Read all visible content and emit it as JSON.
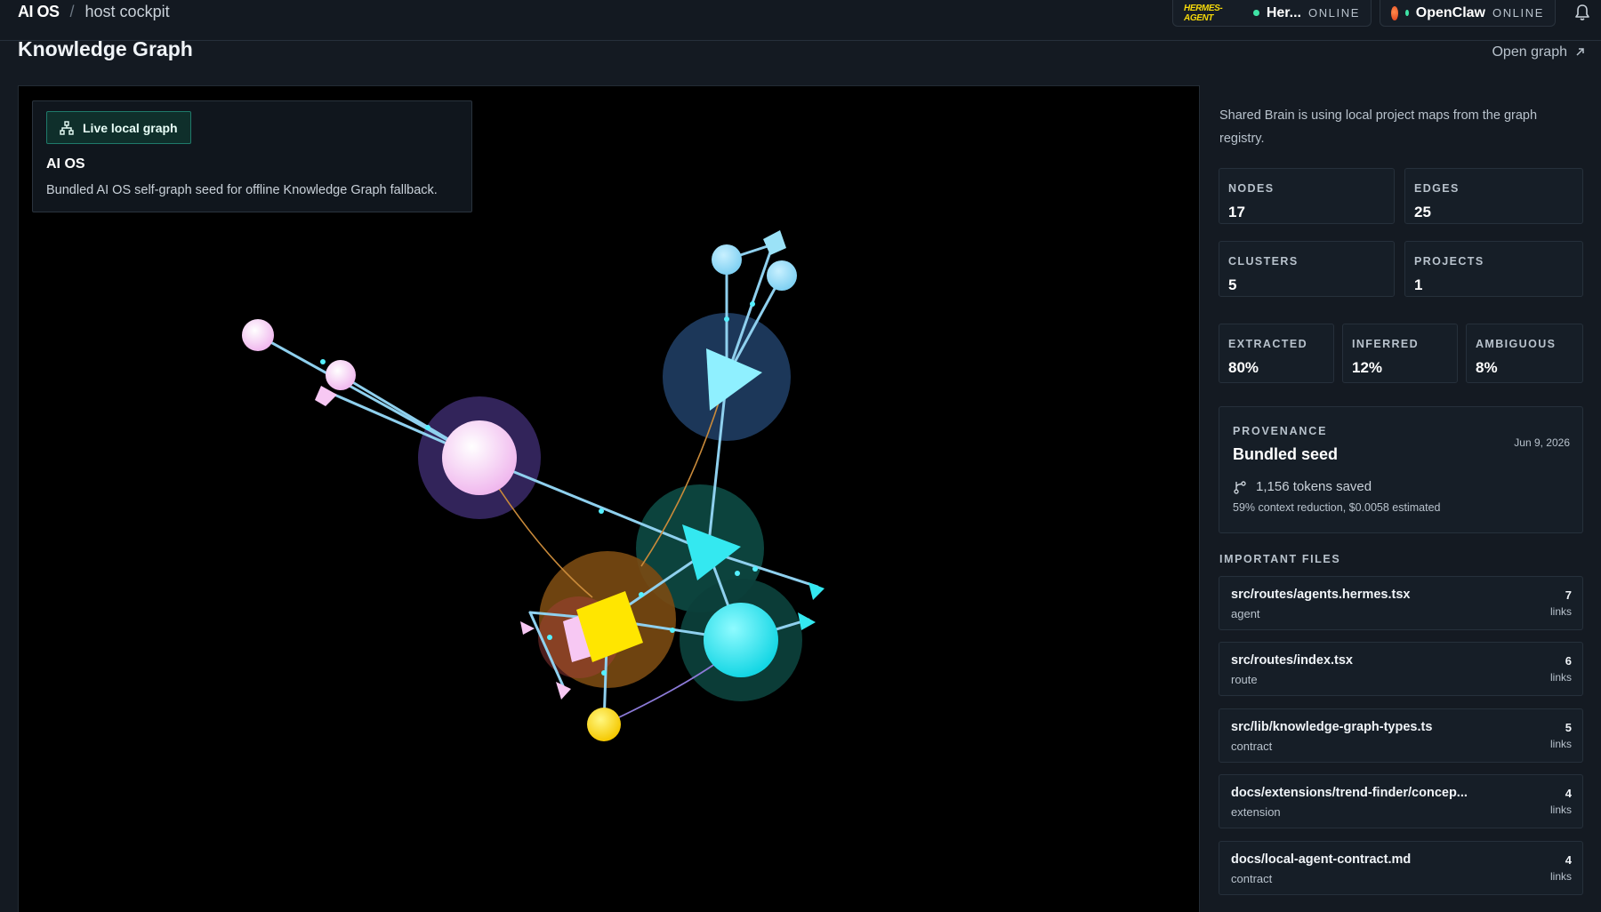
{
  "breadcrumb": {
    "app": "AI OS",
    "separator": "/",
    "page": "host cockpit"
  },
  "agents": [
    {
      "logo_text": "HERMES-AGENT",
      "name": "Her...",
      "status": "ONLINE",
      "status_color": "#3fe3a5"
    },
    {
      "logo_icon": "openclaw-logo-icon",
      "name": "OpenClaw",
      "status": "ONLINE",
      "status_color": "#3fe3a5"
    }
  ],
  "page": {
    "title": "Knowledge Graph",
    "open_graph_label": "Open graph",
    "open_graph_icon": "external-link-icon"
  },
  "graph_card": {
    "badge_label": "Live local graph",
    "badge_icon": "graph-network-icon",
    "title": "AI OS",
    "description": "Bundled AI OS self-graph seed for offline Knowledge Graph fallback."
  },
  "sidebar": {
    "intro": "Shared Brain is using local project maps from the graph registry.",
    "stats": [
      {
        "label": "NODES",
        "value": "17"
      },
      {
        "label": "EDGES",
        "value": "25"
      },
      {
        "label": "CLUSTERS",
        "value": "5"
      },
      {
        "label": "PROJECTS",
        "value": "1"
      }
    ],
    "confidence": [
      {
        "label": "EXTRACTED",
        "value": "80%"
      },
      {
        "label": "INFERRED",
        "value": "12%"
      },
      {
        "label": "AMBIGUOUS",
        "value": "8%"
      }
    ],
    "provenance": {
      "label": "PROVENANCE",
      "title": "Bundled seed",
      "date": "Jun 9, 2026",
      "tokens_icon": "git-branch-icon",
      "tokens": "1,156 tokens saved",
      "note": "59% context reduction, $0.0058 estimated"
    },
    "files_label": "IMPORTANT FILES",
    "files": [
      {
        "name": "src/routes/agents.hermes.tsx",
        "kind": "agent",
        "count": "7",
        "unit": "links"
      },
      {
        "name": "src/routes/index.tsx",
        "kind": "route",
        "count": "6",
        "unit": "links"
      },
      {
        "name": "src/lib/knowledge-graph-types.ts",
        "kind": "contract",
        "count": "5",
        "unit": "links"
      },
      {
        "name": "docs/extensions/trend-finder/concep...",
        "kind": "extension",
        "count": "4",
        "unit": "links"
      },
      {
        "name": "docs/local-agent-contract.md",
        "kind": "contract",
        "count": "4",
        "unit": "links"
      }
    ]
  },
  "colors": {
    "pink": "#f7c8f3",
    "cyan": "#34e8f0",
    "light_blue": "#9be2f7",
    "yellow": "#ffe600",
    "edge": "#8fd0ee",
    "edge_orange": "#c98a3a",
    "edge_purple": "#8c7ad8"
  }
}
